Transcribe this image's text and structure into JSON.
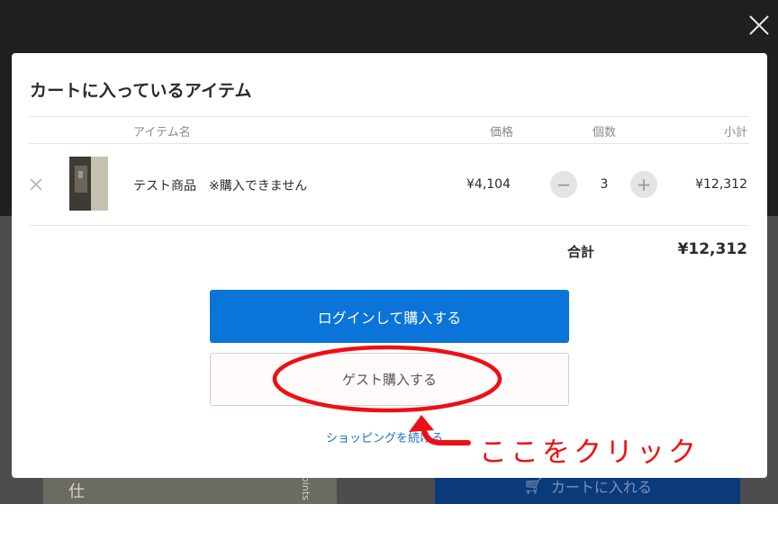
{
  "modal": {
    "title": "カートに入っているアイテム",
    "columns": {
      "item_name": "アイテム名",
      "price": "価格",
      "quantity": "個数",
      "subtotal": "小計"
    },
    "item": {
      "name": "テスト商品　※購入できません",
      "price": "¥4,104",
      "quantity": "3",
      "decrement": "−",
      "increment": "+",
      "subtotal": "¥12,312"
    },
    "total_label": "合計",
    "total_value": "¥12,312",
    "login_button": "ログインして購入する",
    "guest_button": "ゲスト購入する",
    "continue_link": "ショッピングを続ける"
  },
  "background": {
    "cart_button": "カートに入れる",
    "book_glyph": "仕",
    "book_text": "joints"
  },
  "annotation": {
    "text": "ここをクリック",
    "color": "#ee0f14"
  },
  "colors": {
    "primary": "#0a74d8",
    "link": "#1a6ec7"
  }
}
